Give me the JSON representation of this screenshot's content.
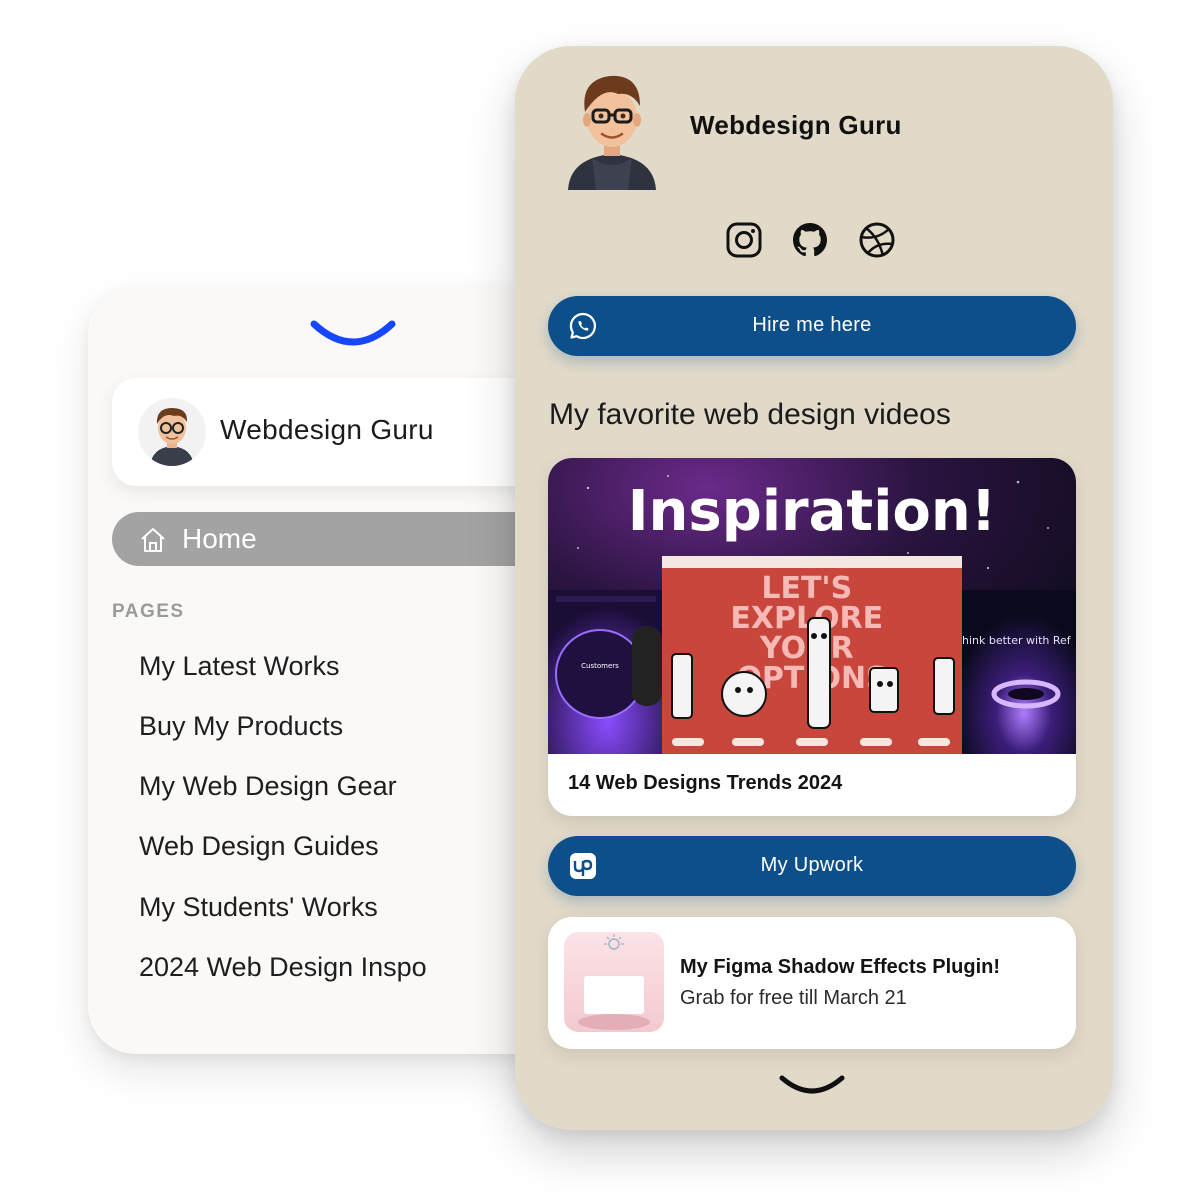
{
  "sidebar": {
    "profile_name": "Webdesign Guru",
    "home_label": "Home",
    "pages_heading": "PAGES",
    "items": [
      {
        "label": "My Latest Works"
      },
      {
        "label": "Buy My Products"
      },
      {
        "label": "My Web Design Gear"
      },
      {
        "label": "Web Design Guides"
      },
      {
        "label": "My Students' Works"
      },
      {
        "label": "2024 Web Design Inspo"
      }
    ]
  },
  "profile": {
    "name": "Webdesign Guru",
    "socials": [
      "instagram-icon",
      "github-icon",
      "dribbble-icon"
    ]
  },
  "hire_button": {
    "label": "Hire me here",
    "icon": "whatsapp-icon"
  },
  "videos_section": {
    "title": "My favorite web design videos"
  },
  "video_card": {
    "thumb_headline": "Inspiration!",
    "thumb_poster": "LET'S EXPLORE YOUR OPTIONS",
    "thumb_left_label": "Customers",
    "thumb_right_label": "hink better with Ref",
    "title": "14 Web Designs Trends 2024"
  },
  "upwork_button": {
    "label": "My Upwork",
    "icon": "upwork-icon"
  },
  "plugin_card": {
    "title": "My Figma Shadow Effects Plugin!",
    "subtitle": "Grab for free till March 21"
  },
  "colors": {
    "button_blue": "#0d4f8b",
    "phone_bg": "#e2dac9",
    "accent_blue": "#1746ff",
    "home_pill": "#a3a3a3"
  }
}
